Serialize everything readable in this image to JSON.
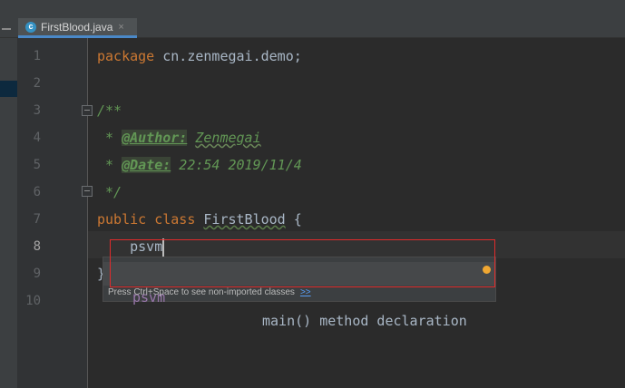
{
  "tab": {
    "filename": "FirstBlood.java",
    "icon_glyph": "c",
    "close_glyph": "×"
  },
  "icons": {
    "tab_icon": "java-class-icon",
    "close": "close-icon",
    "fold": "fold-minus-icon",
    "intention": "lightbulb-icon"
  },
  "colors": {
    "keyword": "#cc7832",
    "comment": "#629755",
    "text": "#a9b7c6",
    "live_template": "#9876aa",
    "selection_tab": "#4a88c7",
    "annotation_box": "#e02b2b"
  },
  "gutter": {
    "line_numbers": [
      "1",
      "2",
      "3",
      "4",
      "5",
      "6",
      "7",
      "8",
      "9",
      "10"
    ]
  },
  "code": {
    "line1": {
      "keyword": "package",
      "rest": " cn.zenmegai.demo;"
    },
    "line3": {
      "text": "/**"
    },
    "line4": {
      "star": " * ",
      "tag": "@Author:",
      "space": " ",
      "value": "Zenmegai"
    },
    "line5": {
      "star": " * ",
      "tag": "@Date:",
      "value": " 22:54 2019/11/4"
    },
    "line6": {
      "text": " */"
    },
    "line7": {
      "kw1": "public",
      "kw2": "class",
      "name": "FirstBlood",
      "brace": " {"
    },
    "line8": {
      "indent": "    ",
      "typed": "psvm"
    },
    "line9": {
      "brace": "}"
    }
  },
  "completion": {
    "abbreviation": "psvm",
    "description": "main() method declaration",
    "footer": "Press Ctrl+Space to see non-imported classes",
    "footer_link": ">>"
  }
}
